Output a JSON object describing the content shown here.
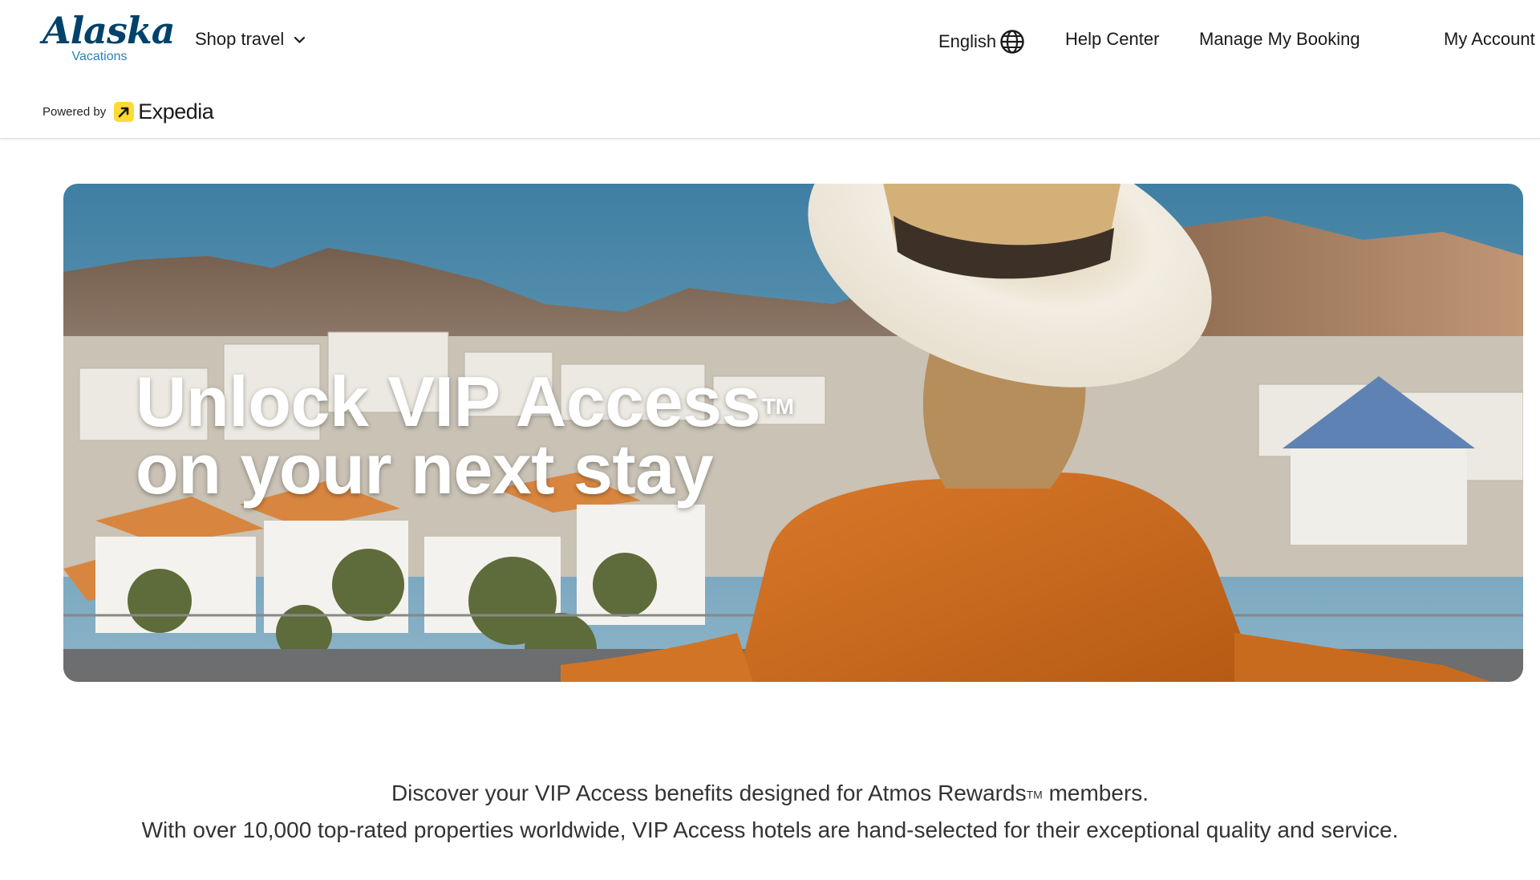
{
  "header": {
    "logo_name": "Alaska",
    "logo_sub": "Vacations",
    "nav": {
      "shop_travel": "Shop travel",
      "language": "English",
      "help_center": "Help Center",
      "manage_booking": "Manage My Booking",
      "my_account": "My Account"
    },
    "powered_by_label": "Powered by",
    "powered_by_brand": "Expedia",
    "brand_color": "#01426a",
    "expedia_badge_color": "#fddb32"
  },
  "hero": {
    "title_line1": "Unlock VIP Access",
    "trademark": "TM",
    "title_line2": "on your next stay"
  },
  "description": {
    "line1_prefix": "Discover your VIP Access benefits designed for Atmos Rewards",
    "line1_tm": "TM",
    "line1_suffix": " members.",
    "line2": "With over 10,000 top-rated properties worldwide, VIP Access hotels are hand-selected for their exceptional quality and service."
  }
}
